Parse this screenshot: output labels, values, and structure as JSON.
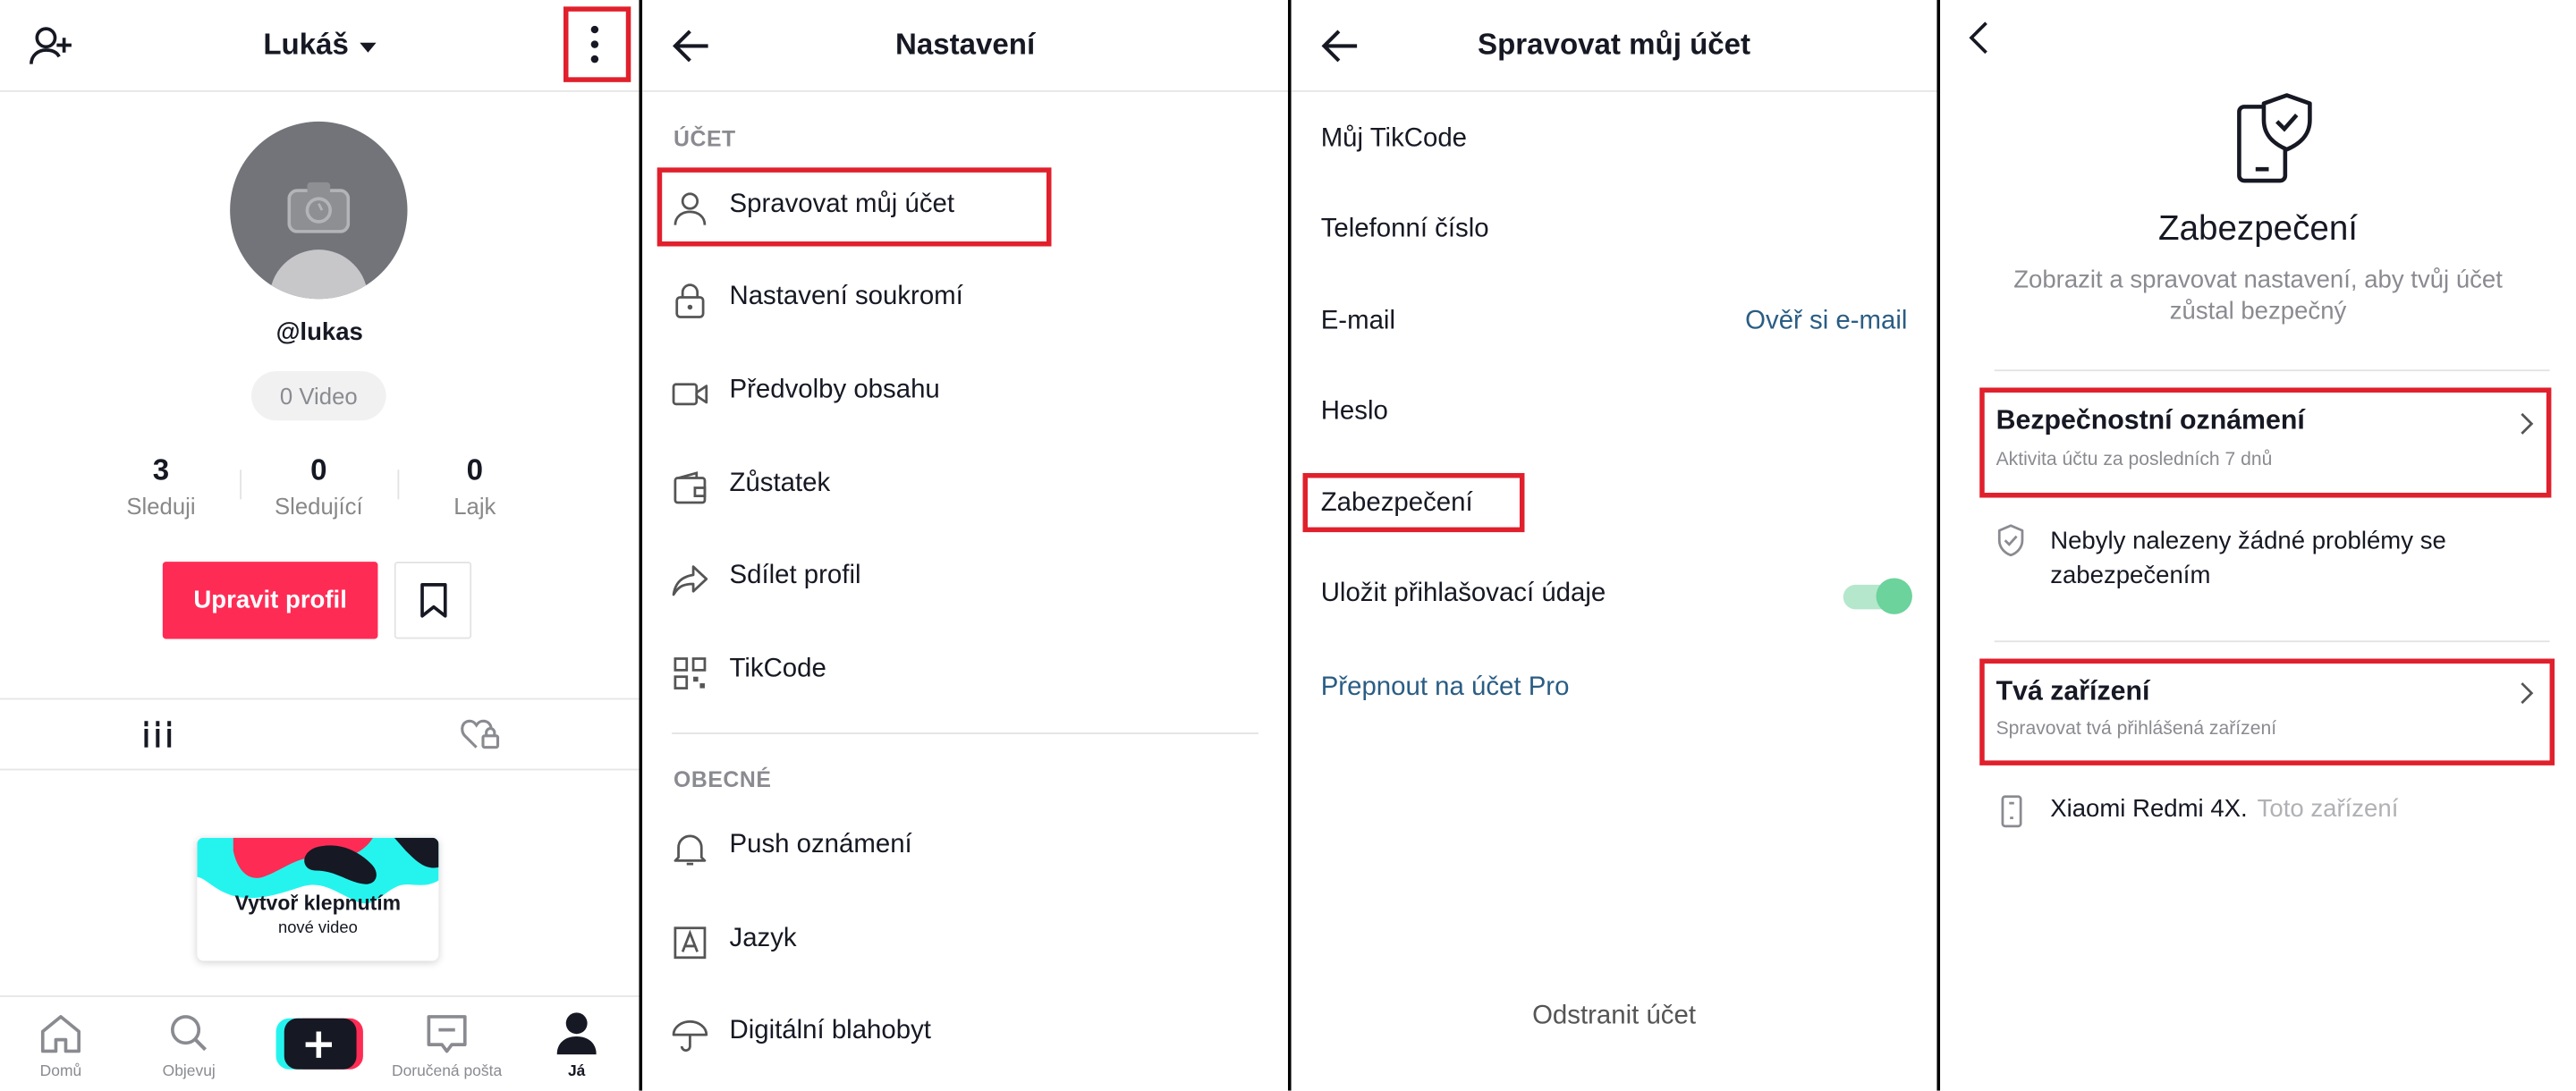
{
  "profile": {
    "username_title": "Lukáš",
    "handle": "@lukas",
    "video_count": "0 Video",
    "stats": [
      {
        "value": "3",
        "label": "Sleduji"
      },
      {
        "value": "0",
        "label": "Sledující"
      },
      {
        "value": "0",
        "label": "Lajk"
      }
    ],
    "edit_button": "Upravit profil",
    "card_line1": "Vytvoř klepnutím",
    "card_line2": "nové video",
    "nav": [
      "Domů",
      "Objevuj",
      "Doručená pošta",
      "Já"
    ]
  },
  "settings": {
    "title": "Nastavení",
    "section_account": "ÚČET",
    "account_items": [
      "Spravovat můj účet",
      "Nastavení soukromí",
      "Předvolby obsahu",
      "Zůstatek",
      "Sdílet profil",
      "TikCode"
    ],
    "section_general": "OBECNÉ",
    "general_items": [
      "Push oznámení",
      "Jazyk",
      "Digitální blahobyt"
    ]
  },
  "manage": {
    "title": "Spravovat můj účet",
    "rows": [
      "Můj TikCode",
      "Telefonní číslo",
      "E-mail",
      "Heslo",
      "Zabezpečení",
      "Uložit přihlašovací údaje"
    ],
    "verify_email": "Ověř si e-mail",
    "switch_pro": "Přepnout na účet Pro",
    "delete_account": "Odstranit účet",
    "save_login_enabled": true
  },
  "security": {
    "title": "Zabezpečení",
    "subtitle": "Zobrazit a spravovat nastavení, aby tvůj účet zůstal bezpečný",
    "alerts_title": "Bezpečnostní oznámení",
    "alerts_sub": "Aktivita účtu za posledních 7 dnů",
    "no_problems": "Nebyly nalezeny žádné problémy se zabezpečením",
    "devices_title": "Tvá zařízení",
    "devices_sub": "Spravovat tvá přihlášená zařízení",
    "device_name": "Xiaomi Redmi 4X.",
    "device_note": "Toto zařízení"
  },
  "colors": {
    "accent": "#fe2c55",
    "highlight": "#e0202c",
    "link": "#2a5d84",
    "toggle": "#6bd39b"
  }
}
